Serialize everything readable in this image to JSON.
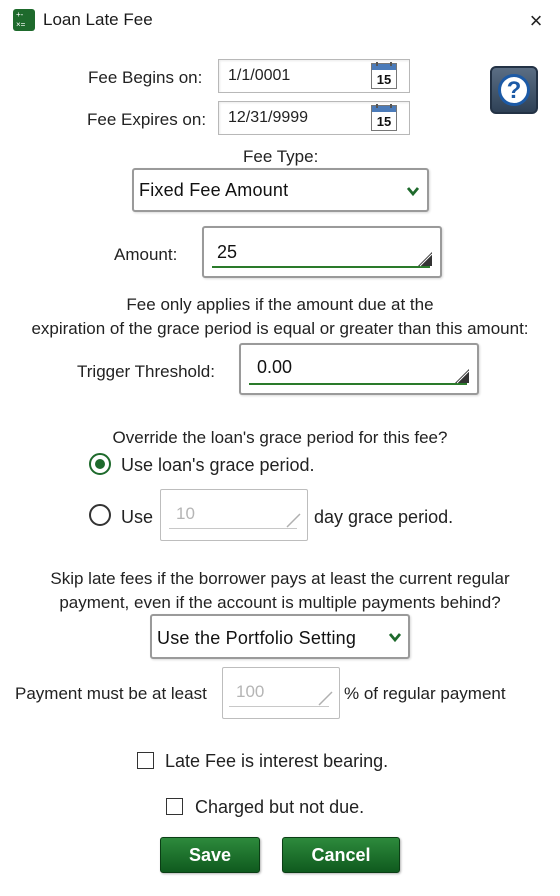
{
  "window": {
    "title": "Loan Late Fee",
    "close_icon": "×"
  },
  "fee_begins": {
    "label": "Fee Begins on:",
    "value": "1/1/0001",
    "calendar_day": "15"
  },
  "fee_expires": {
    "label": "Fee Expires on:",
    "value": "12/31/9999",
    "calendar_day": "15"
  },
  "help": {
    "symbol": "?"
  },
  "fee_type": {
    "label": "Fee Type:",
    "selected": "Fixed Fee Amount"
  },
  "amount": {
    "label": "Amount:",
    "value": "25"
  },
  "threshold_note": {
    "line1": "Fee only applies if the amount due at the",
    "line2": "expiration of the grace period is equal or greater than this amount:"
  },
  "trigger_threshold": {
    "label": "Trigger Threshold:",
    "value": "0.00"
  },
  "grace": {
    "question": "Override the loan's grace period for this fee?",
    "option_loan": "Use loan's grace period.",
    "option_use": "Use",
    "days_value": "10",
    "days_suffix": "day grace period."
  },
  "skip": {
    "line1": "Skip late fees if the borrower pays at least the current regular",
    "line2": "payment, even if the account is multiple payments behind?",
    "selected": "Use the Portfolio Setting"
  },
  "payment_min": {
    "prefix": "Payment must be at least",
    "value": "100",
    "suffix": "% of regular payment"
  },
  "checkboxes": {
    "interest_bearing": "Late Fee is interest bearing.",
    "charged_not_due": "Charged but not due."
  },
  "buttons": {
    "save": "Save",
    "cancel": "Cancel"
  },
  "colors": {
    "accent_green": "#1e6a2c",
    "underline_green": "#2a7a2a",
    "help_blue": "#1c5aa6"
  }
}
